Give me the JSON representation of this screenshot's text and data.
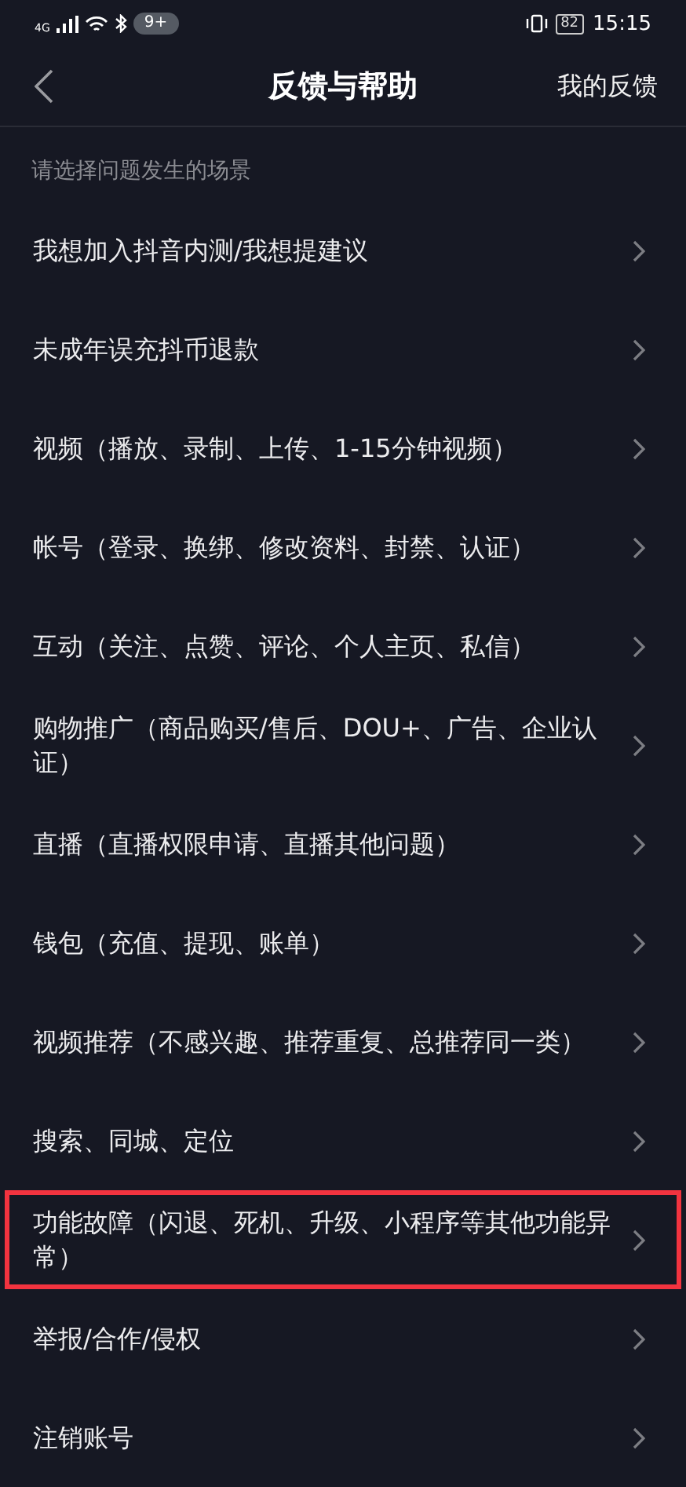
{
  "status_bar": {
    "network": "4G",
    "notifications": "9+",
    "battery": "82",
    "time": "15:15"
  },
  "header": {
    "title": "反馈与帮助",
    "action": "我的反馈"
  },
  "section_label": "请选择问题发生的场景",
  "items": [
    {
      "label": "我想加入抖音内测/我想提建议",
      "highlighted": false
    },
    {
      "label": "未成年误充抖币退款",
      "highlighted": false
    },
    {
      "label": "视频（播放、录制、上传、1-15分钟视频）",
      "highlighted": false
    },
    {
      "label": "帐号（登录、换绑、修改资料、封禁、认证）",
      "highlighted": false
    },
    {
      "label": "互动（关注、点赞、评论、个人主页、私信）",
      "highlighted": false
    },
    {
      "label": "购物推广（商品购买/售后、DOU+、广告、企业认证）",
      "highlighted": false
    },
    {
      "label": "直播（直播权限申请、直播其他问题）",
      "highlighted": false
    },
    {
      "label": "钱包（充值、提现、账单）",
      "highlighted": false
    },
    {
      "label": "视频推荐（不感兴趣、推荐重复、总推荐同一类）",
      "highlighted": false
    },
    {
      "label": "搜索、同城、定位",
      "highlighted": false
    },
    {
      "label": "功能故障（闪退、死机、升级、小程序等其他功能异常）",
      "highlighted": true
    },
    {
      "label": "举报/合作/侵权",
      "highlighted": false
    },
    {
      "label": "注销账号",
      "highlighted": false
    }
  ]
}
